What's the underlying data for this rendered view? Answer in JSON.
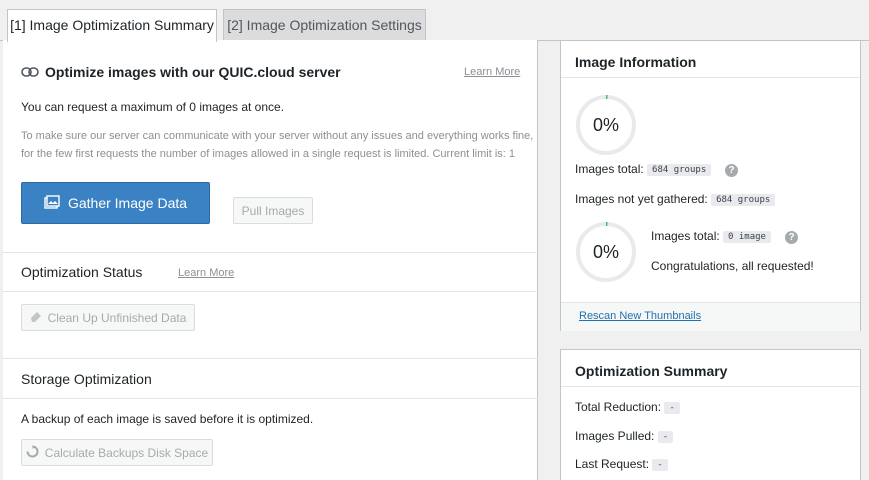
{
  "tabs": [
    {
      "label": "[1] Image Optimization Summary"
    },
    {
      "label": "[2] Image Optimization Settings"
    }
  ],
  "main": {
    "optimize": {
      "title": "Optimize images with our QUIC.cloud server",
      "learn_more": "Learn More",
      "max_text": "You can request a maximum of 0 images at once.",
      "note_line1": "To make sure our server can communicate with your server without any issues and everything works fine,",
      "note_line2": "for the few first requests the number of images allowed in a single request is limited. Current limit is: 1",
      "gather_button": "Gather Image Data",
      "pull_button": "Pull Images"
    },
    "status": {
      "title": "Optimization Status",
      "learn_more": "Learn More",
      "cleanup_button": "Clean Up Unfinished Data"
    },
    "storage": {
      "title": "Storage Optimization",
      "text": "A backup of each image is saved before it is optimized.",
      "calc_button": "Calculate Backups Disk Space"
    }
  },
  "image_info": {
    "title": "Image Information",
    "circle1": "0%",
    "circle1_progress": 0.0,
    "images_total_label": "Images total:",
    "images_total_value": "684 groups",
    "not_gathered_label": "Images not yet gathered:",
    "not_gathered_value": "684 groups",
    "circle2": "0%",
    "circle2_progress": 0.0,
    "images_total2_label": "Images total:",
    "images_total2_value": "0 image",
    "congrats": "Congratulations, all requested!",
    "rescan_link": "Rescan New Thumbnails"
  },
  "summary": {
    "title": "Optimization Summary",
    "total_reduction_label": "Total Reduction:",
    "total_reduction_value": "-",
    "images_pulled_label": "Images Pulled:",
    "images_pulled_value": "-",
    "last_request_label": "Last Request:",
    "last_request_value": "-"
  },
  "icons": {
    "link": "link-icon",
    "image": "image-icon",
    "eraser": "eraser-icon",
    "refresh": "refresh-icon",
    "help": "help-icon"
  },
  "colors": {
    "primary": "#3b82c4",
    "link": "#2271b1",
    "progress": "#4ab866"
  }
}
